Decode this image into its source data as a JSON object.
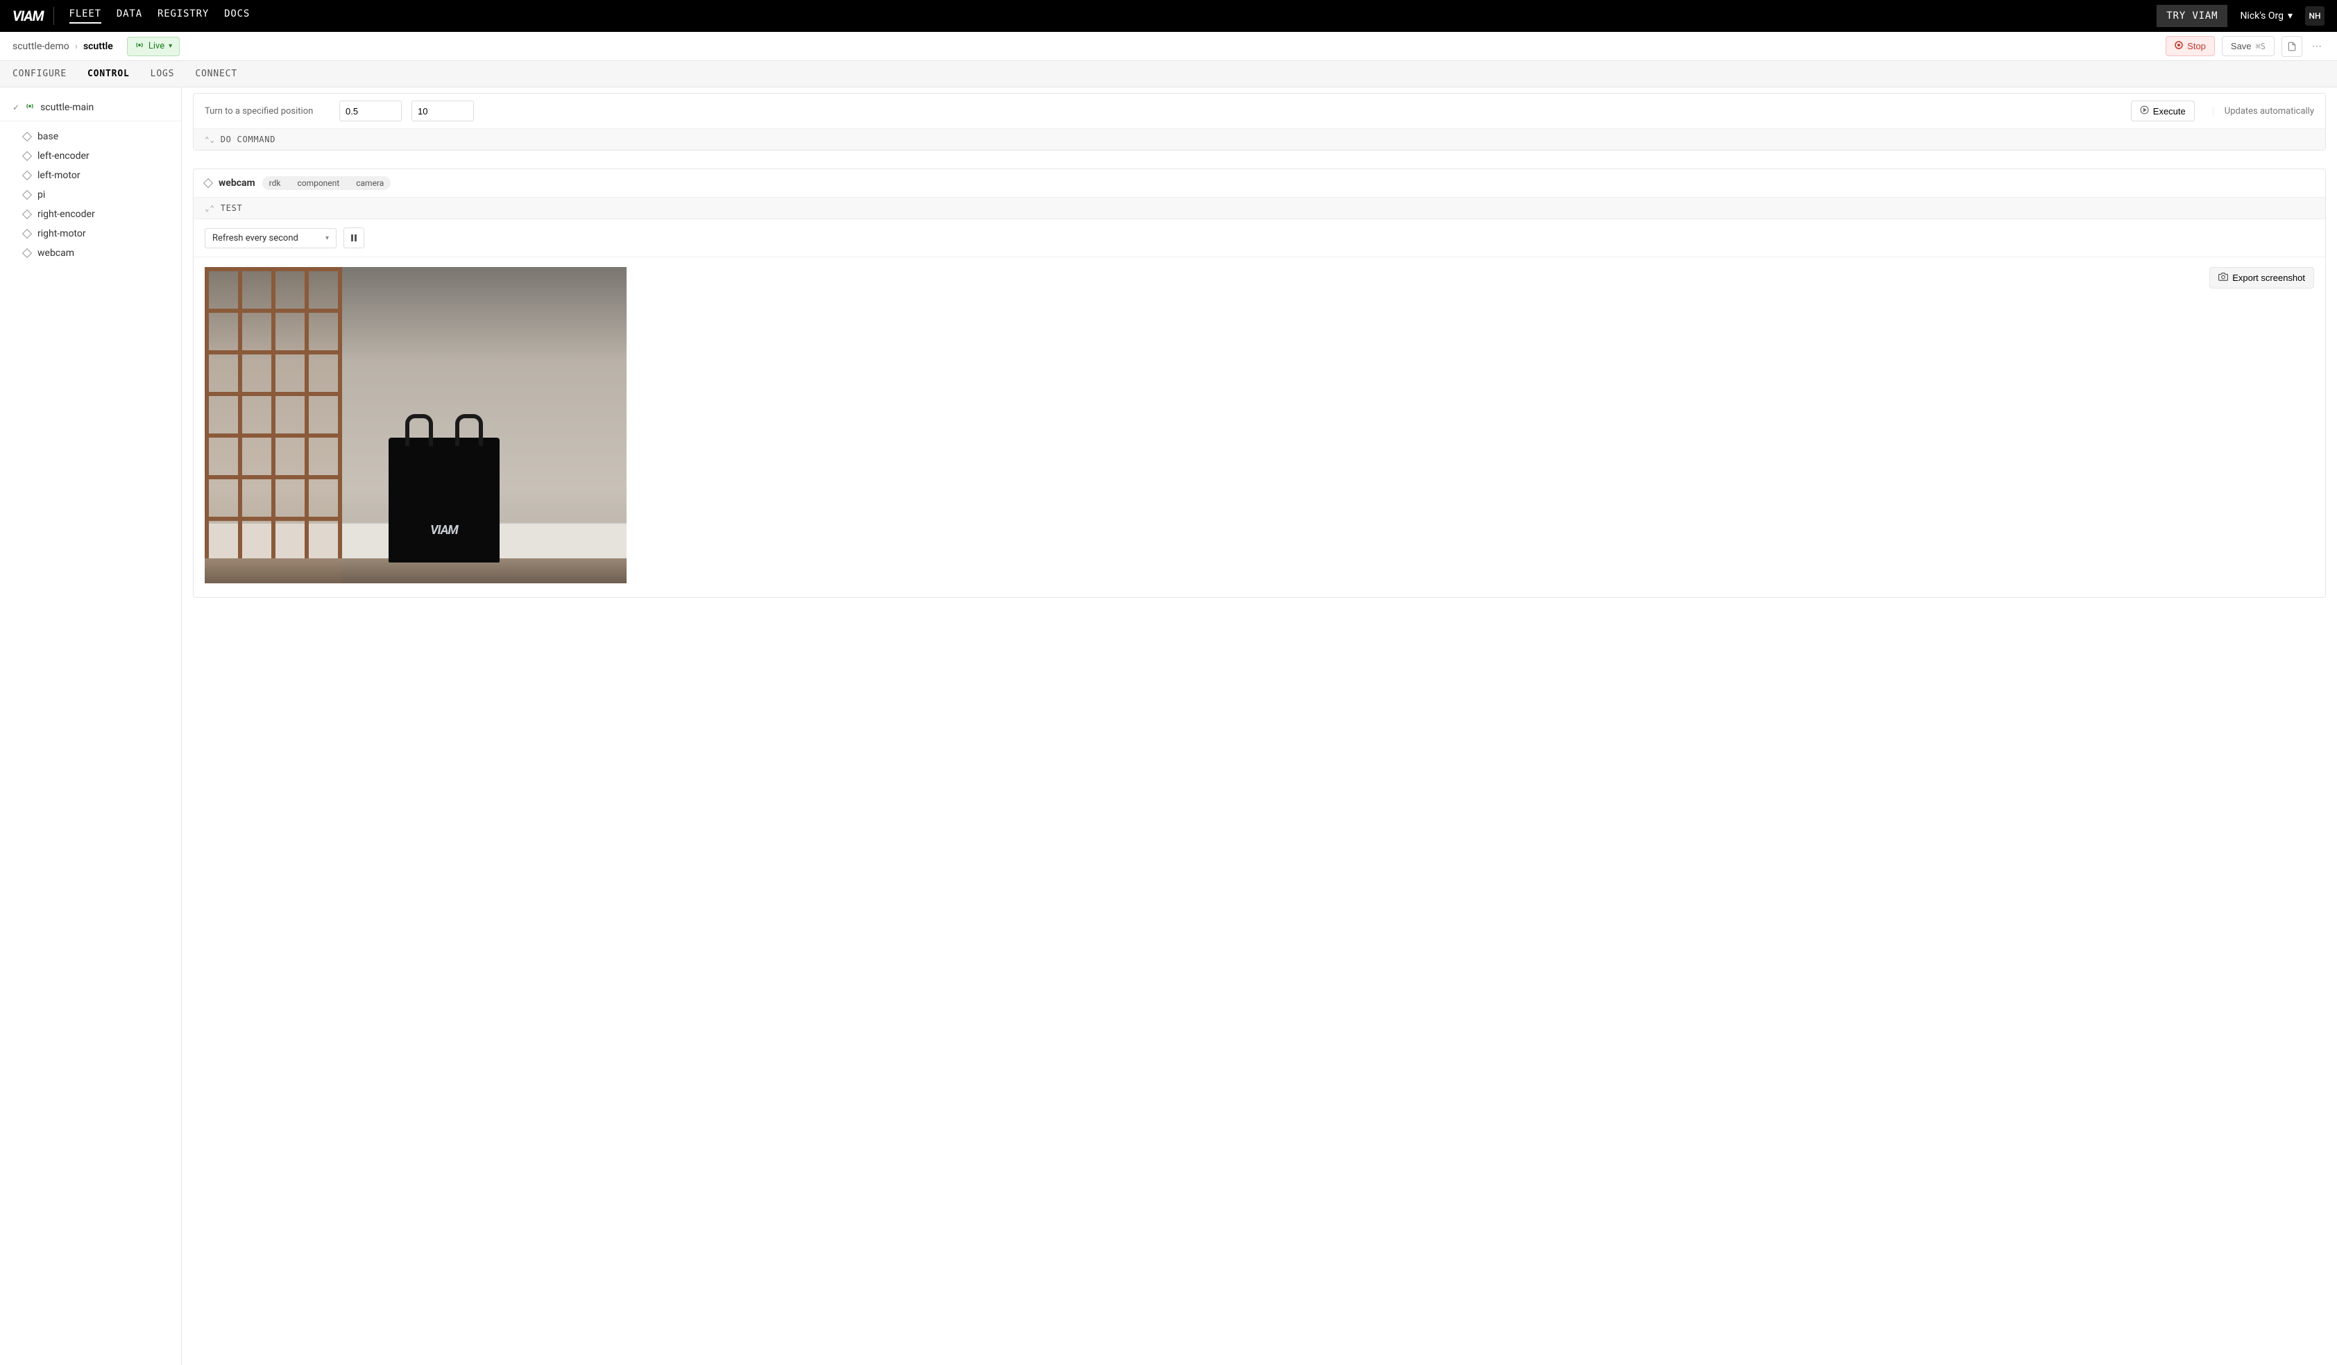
{
  "topbar": {
    "logo": "VIAM",
    "nav": {
      "fleet": "FLEET",
      "data": "DATA",
      "registry": "REGISTRY",
      "docs": "DOCS"
    },
    "try": "TRY VIAM",
    "org": "Nick's Org",
    "initials": "NH"
  },
  "crumb": {
    "parent": "scuttle-demo",
    "current": "scuttle",
    "live": "Live",
    "stop": "Stop",
    "save": "Save",
    "save_shortcut": "⌘S"
  },
  "tabs": {
    "configure": "CONFIGURE",
    "control": "CONTROL",
    "logs": "LOGS",
    "connect": "CONNECT"
  },
  "sidebar": {
    "main": "scuttle-main",
    "items": [
      "base",
      "left-encoder",
      "left-motor",
      "pi",
      "right-encoder",
      "right-motor",
      "webcam"
    ]
  },
  "turn": {
    "label": "Turn to a specified position",
    "val1": "0.5",
    "val2": "10",
    "execute": "Execute",
    "updates": "Updates automatically"
  },
  "do_command": "DO COMMAND",
  "webcam": {
    "name": "webcam",
    "tags": [
      "rdk",
      "component",
      "camera"
    ],
    "test": "TEST",
    "refresh": "Refresh every second",
    "export": "Export screenshot",
    "bag_logo": "VIAM"
  }
}
